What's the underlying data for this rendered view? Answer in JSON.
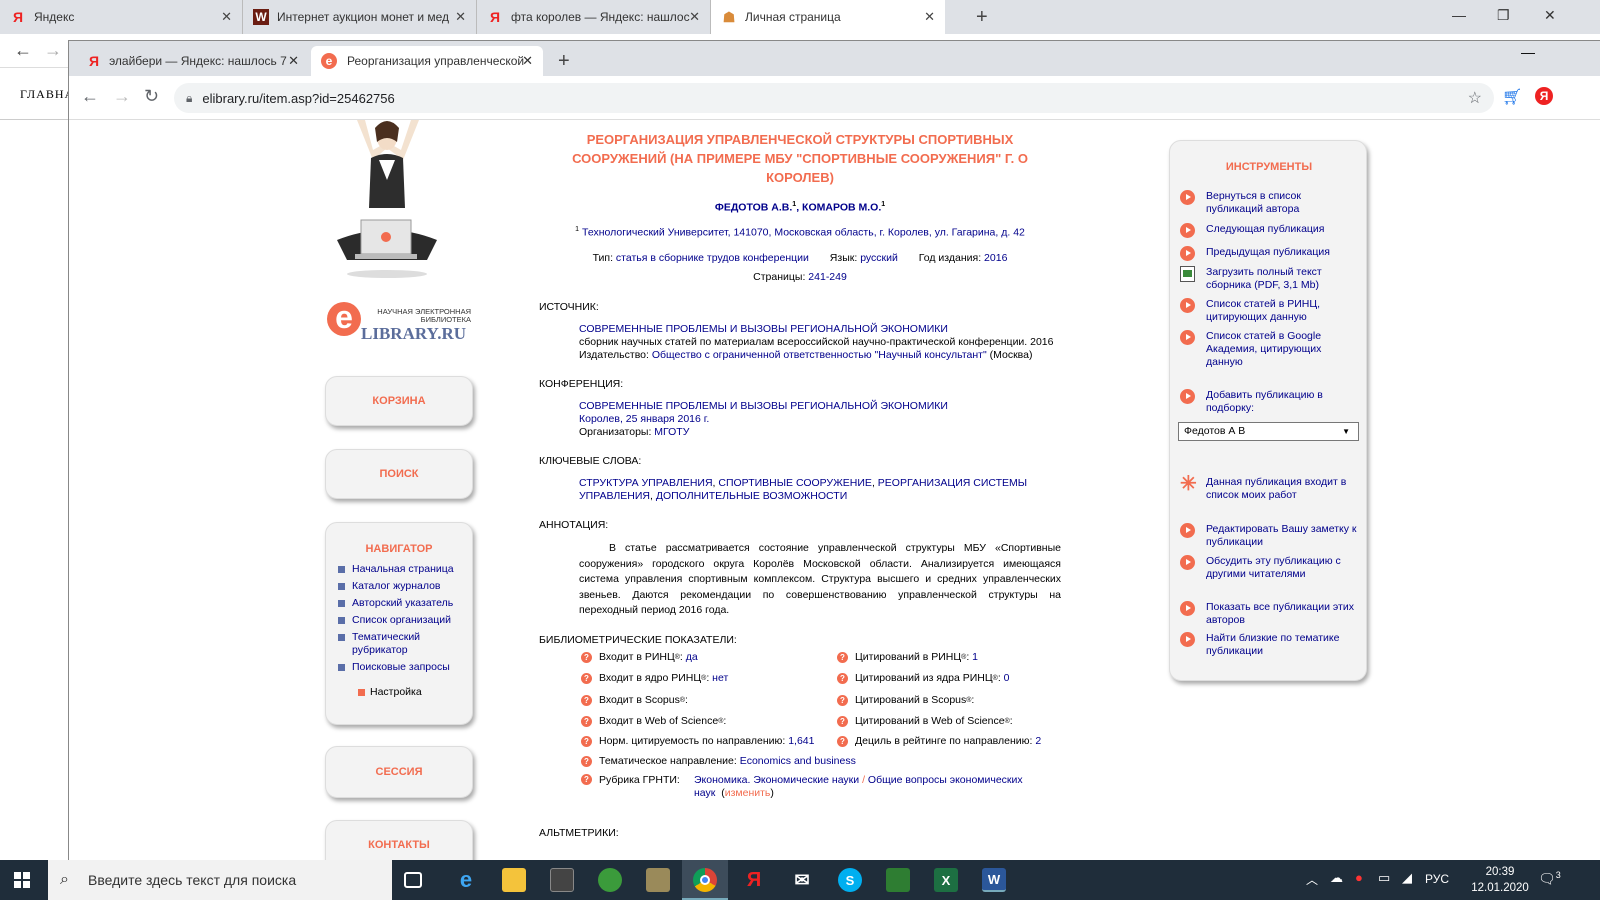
{
  "back_window": {
    "tabs": [
      {
        "favicon": "Я",
        "label": "Яндекс"
      },
      {
        "favicon": "W",
        "label": "Интернет аукцион монет и мед"
      },
      {
        "favicon": "Я",
        "label": "фта королев — Яндекс: нашлос"
      },
      {
        "favicon": "☗",
        "label": "Личная страница"
      }
    ],
    "side_label": "ГЛАВНА"
  },
  "front_window": {
    "tabs": [
      {
        "favicon": "Я",
        "label": "элайбери — Яндекс: нашлось 7"
      },
      {
        "favicon": "e",
        "label": "Реорганизация управленческой"
      }
    ],
    "url": "elibrary.ru/item.asp?id=25462756"
  },
  "left": {
    "logo_small": "НАУЧНАЯ ЭЛЕКТРОННАЯ БИБЛИОТЕКА",
    "logo_big": "LIBRARY.RU",
    "cart": "КОРЗИНА",
    "search": "ПОИСК",
    "navigator_title": "НАВИГАТОР",
    "nav_items": [
      "Начальная страница",
      "Каталог журналов",
      "Авторский указатель",
      "Список организаций",
      "Тематический рубрикатор",
      "Поисковые запросы"
    ],
    "settings": "Настройка",
    "session": "СЕССИЯ",
    "contacts": "КОНТАКТЫ"
  },
  "article": {
    "title": "РЕОРГАНИЗАЦИЯ УПРАВЛЕНЧЕСКОЙ СТРУКТУРЫ СПОРТИВНЫХ СООРУЖЕНИЙ (НА ПРИМЕРЕ МБУ \"СПОРТИВНЫЕ СООРУЖЕНИЯ\" Г. О КОРОЛЕВ)",
    "author1": "ФЕДОТОВ А.В.",
    "author2": "КОМАРОВ М.О.",
    "sup": "1",
    "affiliation": "Технологический Университет, 141070, Московская область, г. Королев, ул. Гагарина, д. 42",
    "type_label": "Тип:",
    "type_value": "статья в сборнике трудов конференции",
    "lang_label": "Язык:",
    "lang_value": "русский",
    "year_label": "Год издания:",
    "year_value": "2016",
    "pages_label": "Страницы:",
    "pages_value": "241-249",
    "source_h": "ИСТОЧНИК:",
    "source_title": "СОВРЕМЕННЫЕ ПРОБЛЕМЫ И ВЫЗОВЫ РЕГИОНАЛЬНОЙ ЭКОНОМИКИ",
    "source_desc": "сборник научных статей по материалам всероссийской научно-практической конференции. 2016",
    "publisher_label": "Издательство:",
    "publisher": "Общество с ограниченной ответственностью \"Научный консультант\"",
    "publisher_city": "(Москва)",
    "conf_h": "КОНФЕРЕНЦИЯ:",
    "conf_title": "СОВРЕМЕННЫЕ ПРОБЛЕМЫ И ВЫЗОВЫ РЕГИОНАЛЬНОЙ ЭКОНОМИКИ",
    "conf_place": "Королев, 25 января 2016 г.",
    "conf_org_label": "Организаторы:",
    "conf_org": "МГОТУ",
    "kw_h": "КЛЮЧЕВЫЕ СЛОВА:",
    "keywords": [
      "СТРУКТУРА УПРАВЛЕНИЯ",
      "СПОРТИВНЫЕ СООРУЖЕНИЕ",
      "РЕОРГАНИЗАЦИЯ СИСТЕМЫ УПРАВЛЕНИЯ",
      "ДОПОЛНИТЕЛЬНЫЕ ВОЗМОЖНОСТИ"
    ],
    "abstract_h": "АННОТАЦИЯ:",
    "abstract": "В статье рассматривается состояние управленческой структуры МБУ «Спортивные сооружения» городского округа Королёв Московской области. Анализируется имеющаяся система управления спортивным комплексом. Структура высшего и средних управленческих звеньев. Даются рекомендации по совершенствованию управленческой структуры на переходный период 2016 года.",
    "biblio_h": "БИБЛИОМЕТРИЧЕСКИЕ ПОКАЗАТЕЛИ:",
    "altmetrics_h": "АЛЬТМЕТРИКИ:"
  },
  "metrics": {
    "rinc_in": "Входит в РИНЦ",
    "rinc_in_v": "да",
    "core_in": "Входит в ядро РИНЦ",
    "core_in_v": "нет",
    "scopus_in": "Входит в Scopus",
    "wos_in": "Входит в Web of Science",
    "norm_cit": "Норм. цитируемость по направлению:",
    "norm_cit_v": "1,641",
    "theme_dir": "Тематическое направление:",
    "theme_dir_v": "Economics and business",
    "grnti": "Рубрика ГРНТИ:",
    "grnti_v1": "Экономика. Экономические науки",
    "grnti_sep": "/",
    "grnti_v2": "Общие вопросы экономических наук",
    "grnti_change": "изменить",
    "cit_rinc": "Цитирований в РИНЦ",
    "cit_rinc_v": "1",
    "cit_core": "Цитирований из ядра РИНЦ",
    "cit_core_v": "0",
    "cit_scopus": "Цитирований в Scopus",
    "cit_wos": "Цитирований в Web of Science",
    "decile": "Дециль в рейтинге по направлению:",
    "decile_v": "2",
    "reg": "®",
    "colon": ":",
    "open_paren": "(",
    "close_paren": ")"
  },
  "tools": {
    "title": "ИНСТРУМЕНТЫ",
    "items": [
      "Вернуться в список публикаций автора",
      "Следующая публикация",
      "Предыдущая публикация",
      "Загрузить полный текст сборника (PDF, 3,1 Mb)",
      "Список статей в РИНЦ, цитирующих данную",
      "Список статей в Google Академия, цитирующих данную",
      "Добавить публикацию в подборку:",
      "Данная публикация входит в список моих работ",
      "Редактировать Вашу заметку к публикации",
      "Обсудить эту публикацию с другими читателями",
      "Показать все публикации этих авторов",
      "Найти близкие по тематике публикации"
    ],
    "select_value": "Федотов А В"
  },
  "taskbar": {
    "search_placeholder": "Введите здесь текст для поиска",
    "lang": "РУС",
    "time": "20:39",
    "date": "12.01.2020",
    "notif": "3"
  }
}
